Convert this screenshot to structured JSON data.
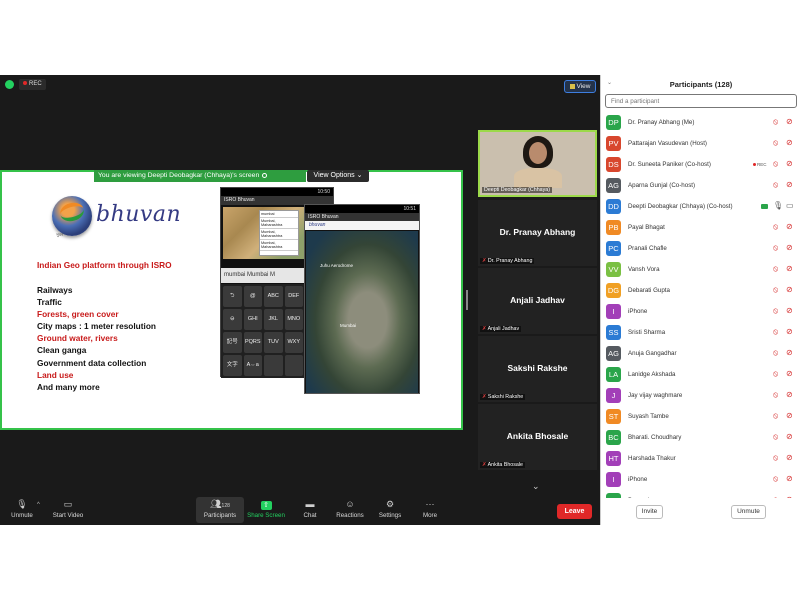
{
  "topbar": {
    "rec_label": "REC",
    "view_label": "View"
  },
  "share": {
    "banner_text": "You are viewing Deepti Deobagkar (Chhaya)'s screen",
    "view_options_label": "View Options"
  },
  "slide": {
    "logo_text": "bhuvan",
    "logo_caption": "भुवन",
    "heading": "Indian Geo platform through ISRO",
    "bullets": [
      {
        "text": "Railways",
        "red": false
      },
      {
        "text": "Traffic",
        "red": false
      },
      {
        "text": "Forests, green cover",
        "red": true
      },
      {
        "text": "City maps : 1 meter resolution",
        "red": false
      },
      {
        "text": "Ground water, rivers",
        "red": true
      },
      {
        "text": "Clean ganga",
        "red": false
      },
      {
        "text": "Government data collection",
        "red": false
      },
      {
        "text": "Land use",
        "red": true
      },
      {
        "text": "And many more",
        "red": false
      }
    ],
    "phone1": {
      "time": "10:50",
      "title": "ISRO Bhuvan",
      "suggestions": [
        "mumbai",
        "Mumbai, Maharashtra",
        "Mumbai, Maharashtra",
        "Mumbai, Maharashtra"
      ],
      "search_text": "mumbai   Mumbai   M",
      "keys": [
        "⮌",
        "@",
        "ABC",
        "DEF",
        "⊖",
        "GHI",
        "JKL",
        "MNO",
        "記号",
        "PQRS",
        "TUV",
        "WXY",
        "文字",
        "A⇔a",
        "",
        ""
      ]
    },
    "phone2": {
      "time": "10:51",
      "title": "ISRO Bhuvan",
      "toolbar": "bhuvan",
      "label_a": "Juhu Aerodrome",
      "label_b": "Mumbai"
    }
  },
  "tiles": [
    {
      "name": "",
      "caption": "Deepti Deobagkar (Chhaya)"
    },
    {
      "name": "Dr. Pranay Abhang",
      "caption": "Dr. Pranay Abhang"
    },
    {
      "name": "Anjali Jadhav",
      "caption": "Anjali Jadhav"
    },
    {
      "name": "Sakshi Rakshe",
      "caption": "Sakshi Rakshe"
    },
    {
      "name": "Ankita Bhosale",
      "caption": "Ankita Bhosale"
    }
  ],
  "toolbar": {
    "unmute": "Unmute",
    "start_video": "Start Video",
    "participants": "Participants",
    "participants_count": "128",
    "share_screen": "Share Screen",
    "chat": "Chat",
    "reactions": "Reactions",
    "settings": "Settings",
    "more": "More",
    "leave": "Leave"
  },
  "panel": {
    "title": "Participants (128)",
    "search_placeholder": "Find a participant",
    "invite": "Invite",
    "unmute": "Unmute",
    "participants": [
      {
        "initials": "DP",
        "name": "Dr. Pranay Abhang (Me)",
        "color": "#2aa54a"
      },
      {
        "initials": "PV",
        "name": "Pattarajan Vasudevan (Host)",
        "color": "#d8472e"
      },
      {
        "initials": "DS",
        "name": "Dr. Suneeta Paniker (Co-host)",
        "color": "#d8472e",
        "rec": "REC"
      },
      {
        "initials": "AG",
        "name": "Aparna Gunjal (Co-host)",
        "color": "#555a60"
      },
      {
        "initials": "DD",
        "name": "Deepti Deobagkar (Chhaya) (Co-host)",
        "color": "#2b7bd4",
        "sharing": true
      },
      {
        "initials": "PB",
        "name": "Payal Bhagat",
        "color": "#f08a24"
      },
      {
        "initials": "PC",
        "name": "Pranali Chafle",
        "color": "#2b7bd4"
      },
      {
        "initials": "VV",
        "name": "Vansh Vora",
        "color": "#7ac043"
      },
      {
        "initials": "DG",
        "name": "Debarati Gupta",
        "color": "#f0a024"
      },
      {
        "initials": "I",
        "name": "iPhone",
        "color": "#a23fb8"
      },
      {
        "initials": "SS",
        "name": "Sristi Sharma",
        "color": "#2b7bd4"
      },
      {
        "initials": "AG",
        "name": "Anuja Gangadhar",
        "color": "#555a60"
      },
      {
        "initials": "LA",
        "name": "Lanidge Akshada",
        "color": "#2aa54a"
      },
      {
        "initials": "J",
        "name": "Jay vijay waghmare",
        "color": "#a23fb8"
      },
      {
        "initials": "ST",
        "name": "Suyash Tambe",
        "color": "#f08a24"
      },
      {
        "initials": "BC",
        "name": "Bharati. Choudhary",
        "color": "#2aa54a"
      },
      {
        "initials": "HT",
        "name": "Harshada Thakur",
        "color": "#a23fb8"
      },
      {
        "initials": "I",
        "name": "iPhone",
        "color": "#a23fb8"
      },
      {
        "initials": "D",
        "name": "Devendra",
        "color": "#2aa54a"
      }
    ]
  }
}
